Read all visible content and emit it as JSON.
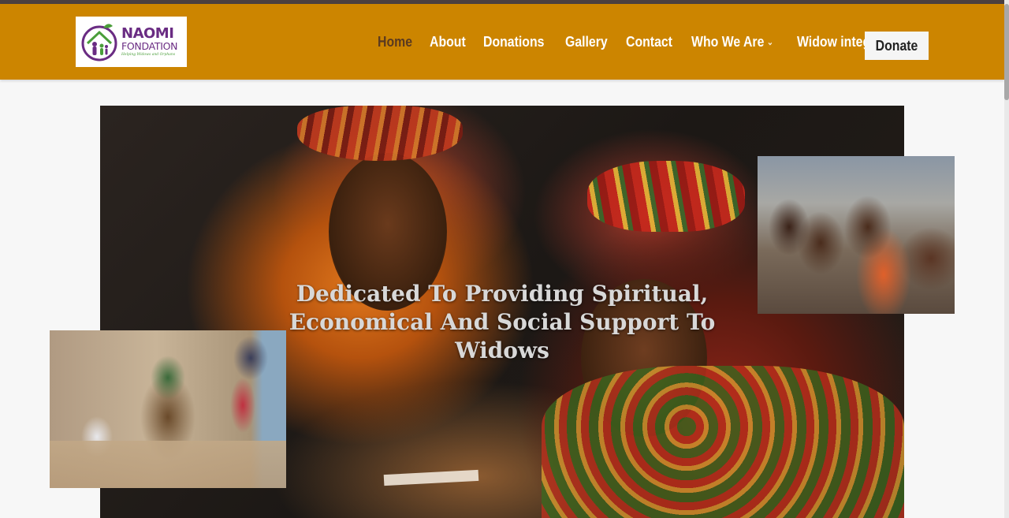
{
  "brand": {
    "name": "NAOMI",
    "subname": "FONDATION",
    "tagline": "Helping Widows and Orphans",
    "colors": {
      "header": "#cc8500",
      "purple": "#6a2c83",
      "green": "#4a9e3a"
    }
  },
  "nav": {
    "items": [
      {
        "label": "Home",
        "active": true
      },
      {
        "label": "About"
      },
      {
        "label": "Donations"
      },
      {
        "label": "Gallery"
      },
      {
        "label": "Contact"
      },
      {
        "label": "Who We Are",
        "dropdown": true
      },
      {
        "label": "Widow integration",
        "dropdown": true
      }
    ],
    "donate_label": "Donate",
    "chevron": "⌄"
  },
  "hero": {
    "title_lines": [
      "Dedicated To Providing Spiritual,",
      "Economical And Social Support To",
      "Widows"
    ]
  }
}
